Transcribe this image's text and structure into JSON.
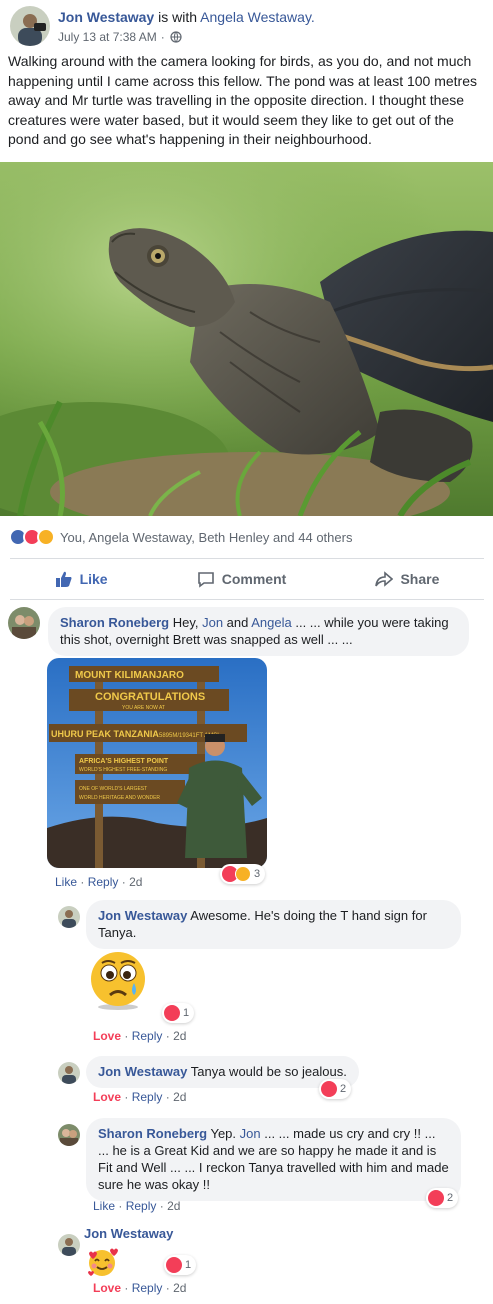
{
  "post": {
    "author": "Jon Westaway",
    "with_text": "is with",
    "tagged": "Angela Westaway.",
    "time": "July 13 at 7:38 AM",
    "dot": "·",
    "text": "Walking around with the camera looking for birds, as you do, and not much happening until I came across this fellow. The pond was at least 100 metres away and Mr turtle was travelling in the opposite direction. I thought these creatures were water based, but it would seem they like to get out of the pond and go see what's happening in their neighbourhood."
  },
  "reactions": {
    "summary": "You, Angela Westaway, Beth Henley and 44 others",
    "icons": [
      "like-icon",
      "love-icon",
      "wow-icon"
    ]
  },
  "actions": {
    "like": "Like",
    "comment": "Comment",
    "share": "Share"
  },
  "comments": [
    {
      "author": "Sharon Roneberg",
      "text_a": "Hey, ",
      "link1": "Jon",
      "text_b": " and ",
      "link2": "Angela",
      "text_c": " ... ... while you were taking this shot, overnight Brett was snapped as well ... ...",
      "actions": {
        "a": "Like",
        "b": "Reply",
        "time": "2d"
      },
      "reaction_count": "3",
      "photo_signs": [
        "MOUNT KILIMANJARO",
        "CONGRATULATIONS",
        "YOU ARE NOW AT",
        "UHURU PEAK TANZANIA",
        "5895M/19341FT AMSL",
        "AFRICA'S HIGHEST POINT",
        "WORLD'S HIGHEST FREE-STANDING",
        "ONE OF WORLD'S LARGEST",
        "WORLD HERITAGE AND WONDER"
      ]
    },
    {
      "author": "Jon Westaway",
      "text": "Awesome. He's doing the T hand sign for Tanya.",
      "actions": {
        "a": "Love",
        "b": "Reply",
        "time": "2d"
      },
      "reaction_count": "1"
    },
    {
      "author": "Jon Westaway",
      "text": "Tanya would be so jealous.",
      "actions": {
        "a": "Love",
        "b": "Reply",
        "time": "2d"
      },
      "reaction_count": "2"
    },
    {
      "author": "Sharon Roneberg",
      "text_a": "Yep. ",
      "link1": "Jon",
      "text_b": " ... ... made us cry and cry !! ... ... he is a Great Kid and we are so happy he made it and is Fit and Well ... ... I reckon Tanya travelled with him and made sure he was okay !!",
      "actions": {
        "a": "Like",
        "b": "Reply",
        "time": "2d"
      },
      "reaction_count": "2"
    },
    {
      "author": "Jon Westaway",
      "actions": {
        "a": "Love",
        "b": "Reply",
        "time": "2d"
      },
      "reaction_count": "1"
    }
  ],
  "colors": {
    "link": "#385898",
    "like_blue": "#4267b2",
    "love_red": "#f33e58",
    "wow_yellow": "#f7b125"
  }
}
